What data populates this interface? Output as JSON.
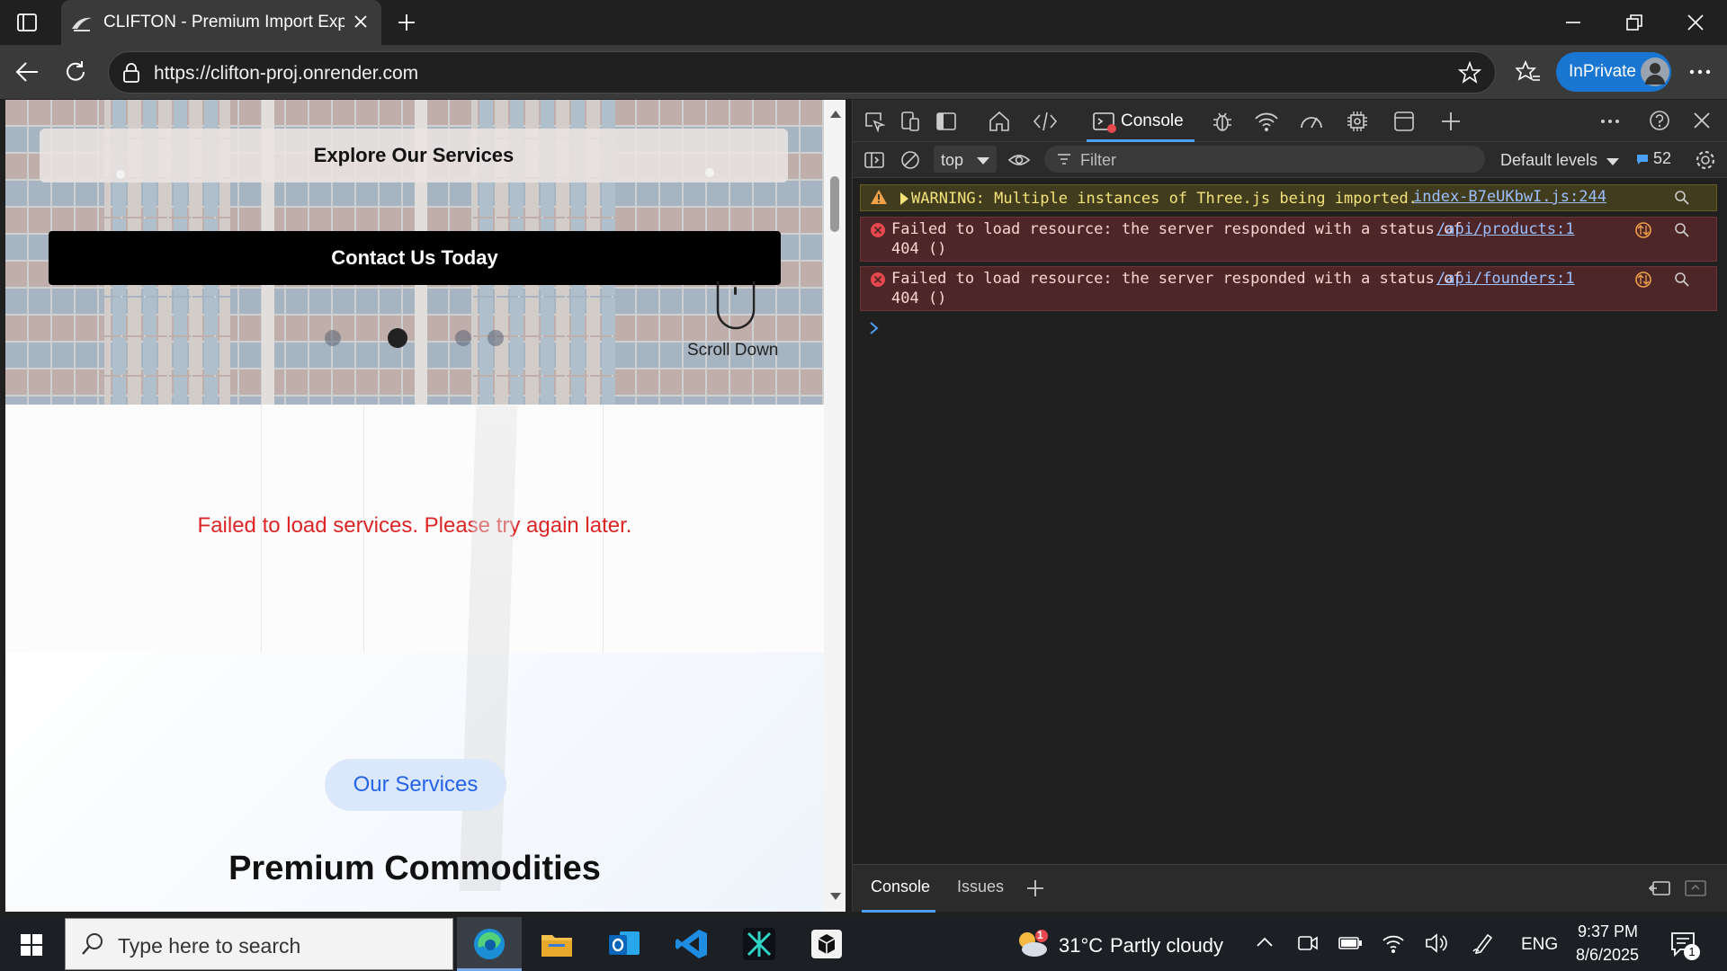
{
  "browser": {
    "tab_title": "CLIFTON - Premium Import Expor",
    "url": "https://clifton-proj.onrender.com",
    "inprivate_label": "InPrivate"
  },
  "page": {
    "explore_button": "Explore Our Services",
    "contact_button": "Contact Us Today",
    "scroll_down": "Scroll Down",
    "services_error": "Failed to load services. Please try again later.",
    "services_badge": "Our Services",
    "section_heading": "Premium Commodities"
  },
  "devtools": {
    "console_tab": "Console",
    "context_select": "top",
    "filter_placeholder": "Filter",
    "levels_label": "Default levels",
    "message_count": "52",
    "messages": [
      {
        "type": "warning",
        "text": "WARNING: Multiple instances of Three.js being imported.",
        "source": "index-B7eUKbwI.js:244"
      },
      {
        "type": "error",
        "text_line1": "Failed to load resource: the server responded with a status of",
        "text_line2": "404 ()",
        "source": "/api/products:1"
      },
      {
        "type": "error",
        "text_line1": "Failed to load resource: the server responded with a status of",
        "text_line2": "404 ()",
        "source": "/api/founders:1"
      }
    ],
    "bottom_tabs": [
      "Console",
      "Issues"
    ]
  },
  "taskbar": {
    "search_placeholder": "Type here to search",
    "weather_temp": "31°C",
    "weather_desc": "Partly cloudy",
    "weather_badge": "1",
    "language": "ENG",
    "time": "9:37 PM",
    "date": "8/6/2025",
    "notification_count": "1"
  },
  "colors": {
    "error_text": "#dc2626",
    "accent": "#1976d2",
    "badge_text": "#2563eb"
  }
}
